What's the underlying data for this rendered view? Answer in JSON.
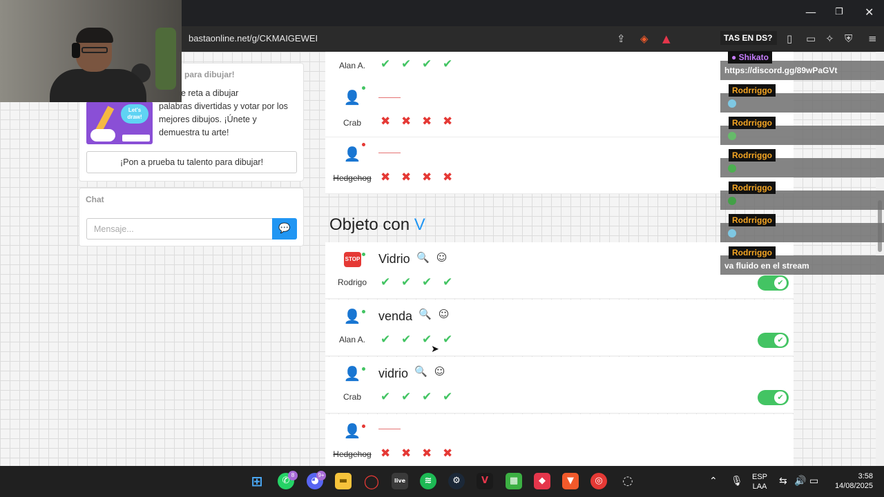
{
  "browser": {
    "url": "bastaonline.net/g/CKMAIGEWEI",
    "window_controls": [
      "minimize",
      "maximize",
      "close"
    ]
  },
  "sidebar": {
    "promo_title": "para dibujar!",
    "promo_lines": [
      "Best te reta a dibujar",
      "palabras divertidas y votar por los",
      "mejores dibujos. ¡Únete y",
      "demuestra tu arte!"
    ],
    "promo_image_text": "Let's draw!",
    "promo_button": "¡Pon a prueba tu talento para dibujar!",
    "chat_label": "Chat",
    "chat_placeholder": "Mensaje..."
  },
  "top_rows": [
    {
      "player": "Alan A.",
      "online": true,
      "word": "",
      "marks": [
        "ok",
        "ok",
        "ok",
        "ok"
      ],
      "struck": false
    },
    {
      "player": "Crab",
      "online": true,
      "word": "",
      "marks": [
        "bad",
        "bad",
        "bad",
        "bad"
      ],
      "struck": false
    },
    {
      "player": "Hedgehog",
      "online": false,
      "word": "",
      "marks": [
        "bad",
        "bad",
        "bad",
        "bad"
      ],
      "struck": true
    }
  ],
  "section": {
    "title": "Objeto con",
    "letter": "V"
  },
  "section_rows": [
    {
      "player": "Rodrigo",
      "avatar": "stop",
      "online": true,
      "word": "Vidrio",
      "marks": [
        "ok",
        "ok",
        "ok",
        "ok"
      ],
      "toggle_on": true,
      "struck": false
    },
    {
      "player": "Alan A.",
      "avatar": "user",
      "online": true,
      "word": "venda",
      "marks": [
        "ok",
        "ok",
        "ok",
        "ok"
      ],
      "toggle_on": true,
      "struck": false
    },
    {
      "player": "Crab",
      "avatar": "user",
      "online": true,
      "word": "vidrio",
      "marks": [
        "ok",
        "ok",
        "ok",
        "ok"
      ],
      "toggle_on": true,
      "struck": false
    },
    {
      "player": "Hedgehog",
      "avatar": "user",
      "online": false,
      "word": "",
      "marks": [
        "bad",
        "bad",
        "bad",
        "bad"
      ],
      "toggle_on": false,
      "struck": true
    }
  ],
  "stream_overlay": {
    "header": "TAS EN DS?",
    "messages": [
      {
        "user": "Shikato",
        "text": "https://discord.gg/89wPaGVt",
        "user_color": "#c77dff"
      },
      {
        "user": "Rodrriggo",
        "text": "",
        "emote": "#7ec8e3"
      },
      {
        "user": "Rodrriggo",
        "text": "",
        "emote": "#66bb6a"
      },
      {
        "user": "Rodrriggo",
        "text": "",
        "emote": "#4caf50"
      },
      {
        "user": "Rodrriggo",
        "text": "",
        "emote": "#43a047"
      },
      {
        "user": "Rodrriggo",
        "text": "",
        "emote": "#7ec8e3"
      },
      {
        "user": "Rodrriggo",
        "text": "va fluido en el stream"
      }
    ]
  },
  "taskbar": {
    "notifications": {
      "whatsapp": "8",
      "discord": "9+"
    },
    "language": "ESP",
    "layout": "LAA",
    "time": "3:58",
    "date": "14/08/2025"
  },
  "colors": {
    "accent": "#2196f3",
    "ok": "#43c463",
    "bad": "#e53935",
    "overlay_name": "#f5a623"
  }
}
